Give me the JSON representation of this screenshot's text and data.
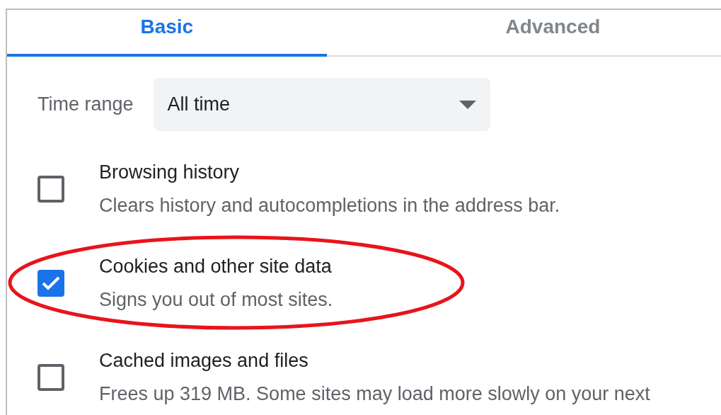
{
  "tabs": [
    {
      "label": "Basic",
      "selected": true
    },
    {
      "label": "Advanced",
      "selected": false
    }
  ],
  "time_range": {
    "label": "Time range",
    "value": "All time"
  },
  "items": [
    {
      "title": "Browsing history",
      "description": "Clears history and autocompletions in the address bar.",
      "checked": false,
      "highlighted": false
    },
    {
      "title": "Cookies and other site data",
      "description": "Signs you out of most sites.",
      "checked": true,
      "highlighted": true
    },
    {
      "title": "Cached images and files",
      "description": "Frees up 319 MB. Some sites may load more slowly on your next",
      "checked": false,
      "highlighted": false
    }
  ]
}
